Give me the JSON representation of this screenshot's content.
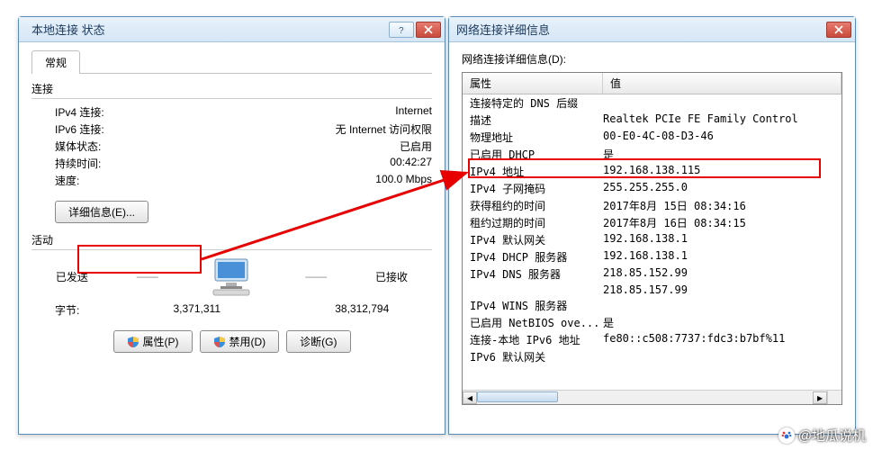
{
  "win1": {
    "title": "本地连接 状态",
    "tab_general": "常规",
    "connection_label": "连接",
    "rows": {
      "ipv4_conn_k": "IPv4 连接:",
      "ipv4_conn_v": "Internet",
      "ipv6_conn_k": "IPv6 连接:",
      "ipv6_conn_v": "无 Internet 访问权限",
      "media_k": "媒体状态:",
      "media_v": "已启用",
      "duration_k": "持续时间:",
      "duration_v": "00:42:27",
      "speed_k": "速度:",
      "speed_v": "100.0 Mbps"
    },
    "details_btn": "详细信息(E)...",
    "activity_label": "活动",
    "sent_label": "已发送",
    "recv_label": "已接收",
    "bytes_label": "字节:",
    "bytes_sent": "3,371,311",
    "bytes_recv": "38,312,794",
    "btn_props": "属性(P)",
    "btn_disable": "禁用(D)",
    "btn_diag": "诊断(G)"
  },
  "win2": {
    "title": "网络连接详细信息",
    "label": "网络连接详细信息(D):",
    "col_prop": "属性",
    "col_val": "值",
    "rows": [
      {
        "k": "连接特定的 DNS 后缀",
        "v": ""
      },
      {
        "k": "描述",
        "v": "Realtek PCIe FE Family Control"
      },
      {
        "k": "物理地址",
        "v": "00-E0-4C-08-D3-46"
      },
      {
        "k": "已启用 DHCP",
        "v": "是"
      },
      {
        "k": "IPv4 地址",
        "v": "192.168.138.115"
      },
      {
        "k": "IPv4 子网掩码",
        "v": "255.255.255.0"
      },
      {
        "k": "获得租约的时间",
        "v": "2017年8月 15日 08:34:16"
      },
      {
        "k": "租约过期的时间",
        "v": "2017年8月 16日 08:34:15"
      },
      {
        "k": "IPv4 默认网关",
        "v": "192.168.138.1"
      },
      {
        "k": "IPv4 DHCP 服务器",
        "v": "192.168.138.1"
      },
      {
        "k": "IPv4 DNS 服务器",
        "v": "218.85.152.99"
      },
      {
        "k": "",
        "v": "218.85.157.99"
      },
      {
        "k": "IPv4 WINS 服务器",
        "v": ""
      },
      {
        "k": "已启用 NetBIOS ove...",
        "v": "是"
      },
      {
        "k": "连接-本地 IPv6 地址",
        "v": "fe80::c508:7737:fdc3:b7bf%11"
      },
      {
        "k": "IPv6 默认网关",
        "v": ""
      }
    ]
  },
  "watermark": "@地瓜说机"
}
